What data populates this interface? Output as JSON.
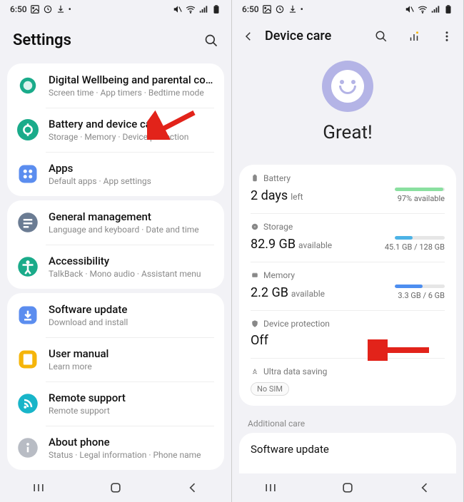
{
  "status": {
    "time": "6:50",
    "icons_left": [
      "image-icon",
      "sync-icon",
      "download-icon",
      "dot-icon"
    ],
    "icons_right": [
      "mute-icon",
      "wifi-icon",
      "signal-icon",
      "battery-icon"
    ]
  },
  "left": {
    "title": "Settings",
    "groups": [
      [
        {
          "icon": "wellbeing",
          "color": "#1aab8a",
          "label": "Digital Wellbeing and parental controls",
          "sub": "Screen time  ·  App timers  ·  Bedtime mode"
        },
        {
          "icon": "battery",
          "color": "#1aab8a",
          "label": "Battery and device care",
          "sub": "Storage  ·  Memory  ·  Device protection"
        },
        {
          "icon": "apps",
          "color": "#5b8def",
          "label": "Apps",
          "sub": "Default apps  ·  App settings"
        }
      ],
      [
        {
          "icon": "general",
          "color": "#6b7c93",
          "label": "General management",
          "sub": "Language and keyboard  ·  Date and time"
        },
        {
          "icon": "accessibility",
          "color": "#1aab8a",
          "label": "Accessibility",
          "sub": "TalkBack  ·  Mono audio  ·  Assistant menu"
        }
      ],
      [
        {
          "icon": "update",
          "color": "#5b8def",
          "label": "Software update",
          "sub": "Download and install"
        },
        {
          "icon": "manual",
          "color": "#f5b50a",
          "label": "User manual",
          "sub": "Learn more"
        },
        {
          "icon": "remote",
          "color": "#18b5c9",
          "label": "Remote support",
          "sub": "Remote support"
        },
        {
          "icon": "about",
          "color": "#b8bcc4",
          "label": "About phone",
          "sub": "Status  ·  Legal information  ·  Phone name"
        }
      ]
    ]
  },
  "right": {
    "title": "Device care",
    "status_text": "Great!",
    "metrics": [
      {
        "icon": "battery",
        "name": "Battery",
        "value": "2 days",
        "unit": "left",
        "right": "97% available",
        "bar": {
          "fill": 97,
          "color": "#8ae0a0"
        }
      },
      {
        "icon": "storage",
        "name": "Storage",
        "value": "82.9 GB",
        "unit": "available",
        "right": "45.1 GB / 128 GB",
        "bar": {
          "fill": 35,
          "color": "#4db3e6"
        }
      },
      {
        "icon": "memory",
        "name": "Memory",
        "value": "2.2 GB",
        "unit": "available",
        "right": "3.3 GB / 6 GB",
        "bar": {
          "fill": 55,
          "color": "#4d8ef0"
        }
      },
      {
        "icon": "shield",
        "name": "Device protection",
        "value": "Off"
      },
      {
        "icon": "datasave",
        "name": "Ultra data saving",
        "pill": "No SIM"
      }
    ],
    "section_label": "Additional care",
    "software_update": "Software update"
  },
  "nav": {
    "recents": "|||",
    "home": "○",
    "back": "‹"
  },
  "colors": {
    "accent_red": "#e2231a"
  }
}
